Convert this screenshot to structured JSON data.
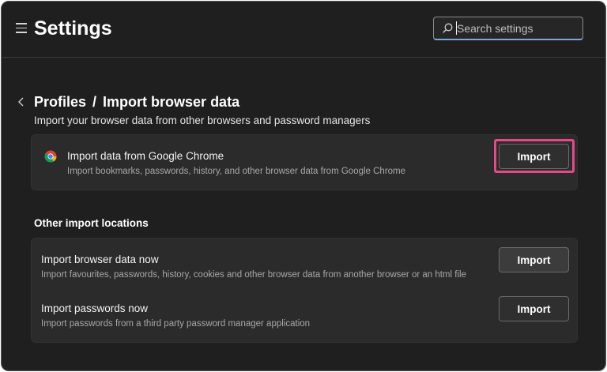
{
  "header": {
    "title": "Settings",
    "search_placeholder": "Search settings"
  },
  "breadcrumb": {
    "parent": "Profiles",
    "separator": "/",
    "current": "Import browser data"
  },
  "subtitle": "Import your browser data from other browsers and password managers",
  "chrome_import": {
    "title": "Import data from Google Chrome",
    "description": "Import bookmarks, passwords, history, and other browser data from Google Chrome",
    "button_label": "Import",
    "highlight_color": "#e8478b"
  },
  "other_locations": {
    "title": "Other import locations",
    "items": [
      {
        "title": "Import browser data now",
        "description": "Import favourites, passwords, history, cookies and other browser data from another browser or an html file",
        "button_label": "Import"
      },
      {
        "title": "Import passwords now",
        "description": "Import passwords from a third party password manager application",
        "button_label": "Import"
      }
    ]
  },
  "colors": {
    "background": "#1f1f1f",
    "card": "#2b2b2b",
    "search_accent": "#7aa7e0"
  },
  "icons": [
    "menu-icon",
    "search-icon",
    "back-chevron-icon",
    "chrome-icon"
  ]
}
